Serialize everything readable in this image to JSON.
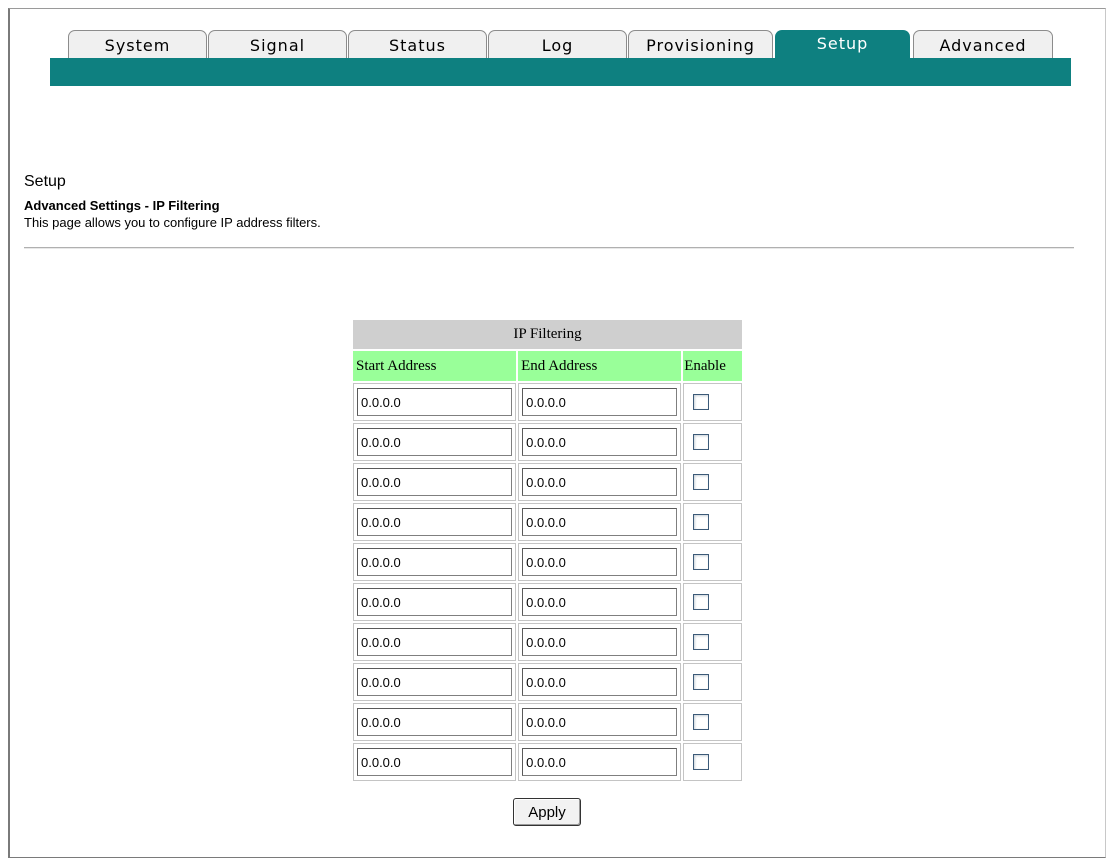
{
  "tabs": [
    {
      "label": "System"
    },
    {
      "label": "Signal"
    },
    {
      "label": "Status"
    },
    {
      "label": "Log"
    },
    {
      "label": "Provisioning"
    },
    {
      "label": "Setup",
      "active": true
    },
    {
      "label": "Advanced"
    }
  ],
  "colors": {
    "accent": "#0e8080",
    "header_bg": "#99ff99",
    "title_bg": "#cfcfcf"
  },
  "page": {
    "title": "Setup",
    "subtitle": "Advanced Settings - IP Filtering",
    "description": "This page allows you to configure IP address filters."
  },
  "ip_filtering": {
    "title": "IP Filtering",
    "columns": {
      "start": "Start Address",
      "end": "End Address",
      "enable": "Enable"
    },
    "rows": [
      {
        "start": "0.0.0.0",
        "end": "0.0.0.0",
        "enabled": false
      },
      {
        "start": "0.0.0.0",
        "end": "0.0.0.0",
        "enabled": false
      },
      {
        "start": "0.0.0.0",
        "end": "0.0.0.0",
        "enabled": false
      },
      {
        "start": "0.0.0.0",
        "end": "0.0.0.0",
        "enabled": false
      },
      {
        "start": "0.0.0.0",
        "end": "0.0.0.0",
        "enabled": false
      },
      {
        "start": "0.0.0.0",
        "end": "0.0.0.0",
        "enabled": false
      },
      {
        "start": "0.0.0.0",
        "end": "0.0.0.0",
        "enabled": false
      },
      {
        "start": "0.0.0.0",
        "end": "0.0.0.0",
        "enabled": false
      },
      {
        "start": "0.0.0.0",
        "end": "0.0.0.0",
        "enabled": false
      },
      {
        "start": "0.0.0.0",
        "end": "0.0.0.0",
        "enabled": false
      }
    ]
  },
  "apply_label": "Apply"
}
